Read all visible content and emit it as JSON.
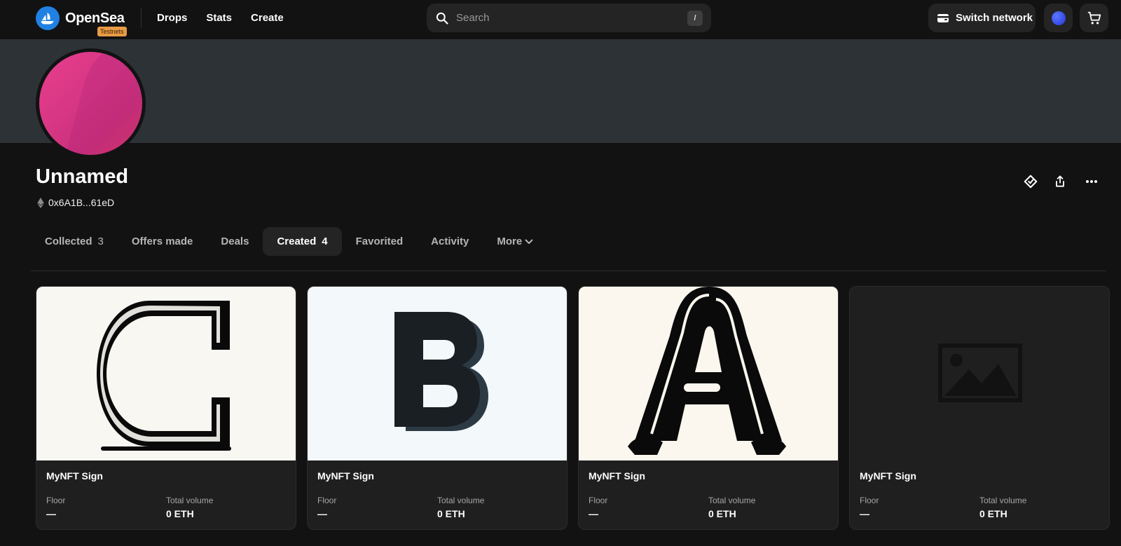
{
  "header": {
    "brand_name": "OpenSea",
    "testnet_badge": "Testnets",
    "nav": [
      {
        "label": "Drops"
      },
      {
        "label": "Stats"
      },
      {
        "label": "Create"
      }
    ],
    "search": {
      "placeholder": "Search",
      "shortcut": "/"
    },
    "switch_network_label": "Switch network"
  },
  "profile": {
    "name": "Unnamed",
    "address": "0x6A1B...61eD"
  },
  "tabs": [
    {
      "label": "Collected",
      "count": "3"
    },
    {
      "label": "Offers made",
      "count": ""
    },
    {
      "label": "Deals",
      "count": ""
    },
    {
      "label": "Created",
      "count": "4",
      "active": true
    },
    {
      "label": "Favorited",
      "count": ""
    },
    {
      "label": "Activity",
      "count": ""
    },
    {
      "label": "More",
      "count": ""
    }
  ],
  "cards": [
    {
      "title": "MyNFT Sign",
      "floor_label": "Floor",
      "floor_value": "—",
      "volume_label": "Total volume",
      "volume_value": "0 ETH",
      "image": "letter-c"
    },
    {
      "title": "MyNFT Sign",
      "floor_label": "Floor",
      "floor_value": "—",
      "volume_label": "Total volume",
      "volume_value": "0 ETH",
      "image": "letter-b"
    },
    {
      "title": "MyNFT Sign",
      "floor_label": "Floor",
      "floor_value": "—",
      "volume_label": "Total volume",
      "volume_value": "0 ETH",
      "image": "letter-a"
    },
    {
      "title": "MyNFT Sign",
      "floor_label": "Floor",
      "floor_value": "—",
      "volume_label": "Total volume",
      "volume_value": "0 ETH",
      "image": "image-placeholder"
    }
  ],
  "colors": {
    "background": "#121212",
    "banner": "#2d3237",
    "accent_blue": "#2081e2",
    "testnet_badge": "#e89b45",
    "profile_pink": "#e83e8c"
  }
}
